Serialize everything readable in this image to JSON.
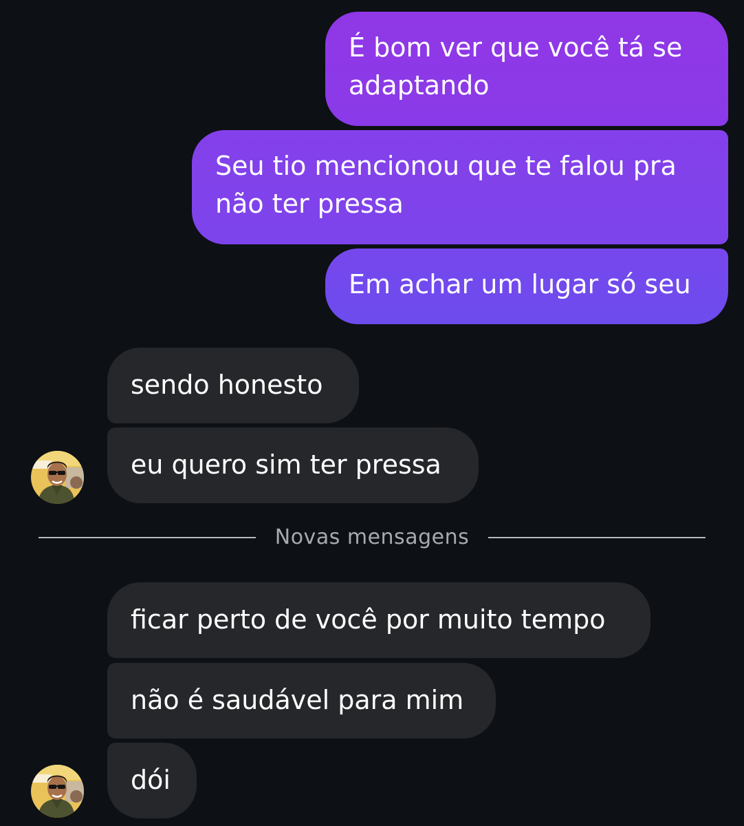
{
  "conversation": {
    "sent_messages": [
      {
        "line1": "É bom ver que você tá se",
        "line2": "adaptando"
      },
      {
        "line1": "Seu tio mencionou que te falou pra",
        "line2": "não ter pressa"
      },
      {
        "text": "Em achar um lugar só seu"
      }
    ],
    "received_before": [
      {
        "text": "sendo honesto"
      },
      {
        "text": "eu quero sim ter pressa"
      }
    ],
    "divider": {
      "label": "Novas mensagens"
    },
    "received_after": [
      {
        "text": "ficar perto de você por muito tempo"
      },
      {
        "text": "não é saudável para mim"
      },
      {
        "text": "dói"
      }
    ]
  },
  "colors": {
    "background": "#0d1014",
    "sent_bubble_top": "#9037e6",
    "sent_bubble_bottom": "#6d4cee",
    "received_bubble": "#25272b",
    "divider": "#b8bbc0"
  },
  "icons": {
    "avatar": "contact-avatar-photo"
  }
}
